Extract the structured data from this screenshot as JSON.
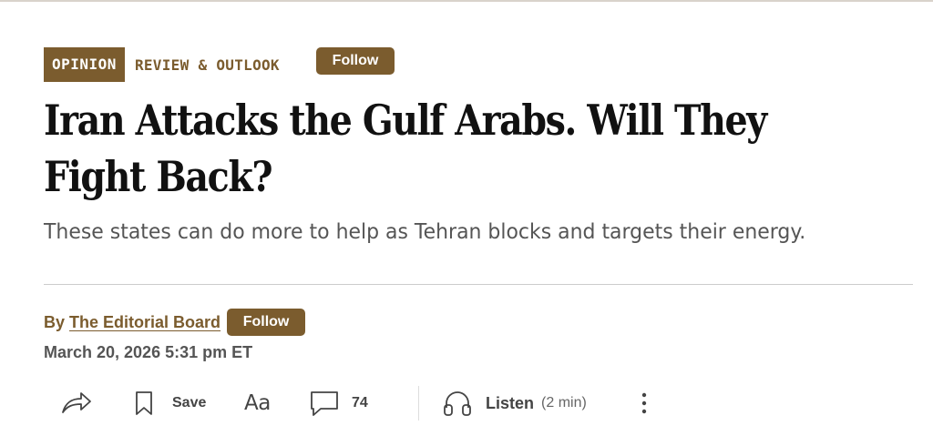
{
  "kicker": {
    "badge": "OPINION",
    "section": "REVIEW & OUTLOOK",
    "follow_label": "Follow"
  },
  "headline": "Iran Attacks the Gulf Arabs. Will They Fight Back?",
  "dek": "These states can do more to help as Tehran blocks and targets their energy.",
  "byline": {
    "prefix": "By",
    "author": "The Editorial Board",
    "follow_label": "Follow"
  },
  "dateline": "March 20, 2026 5:31 pm ET",
  "toolbar": {
    "share_icon": "share-arrow-icon",
    "save_icon": "bookmark-icon",
    "save_label": "Save",
    "text_size_label": "Aa",
    "comment_icon": "comment-bubble-icon",
    "comment_count": "74",
    "listen_icon": "headphones-icon",
    "listen_label": "Listen",
    "listen_duration": "(2 min)",
    "more_icon": "more-vertical-icon"
  },
  "colors": {
    "accent": "#7b5c2e",
    "headline": "#111111",
    "dek": "#555555",
    "divider": "#cccccc"
  }
}
